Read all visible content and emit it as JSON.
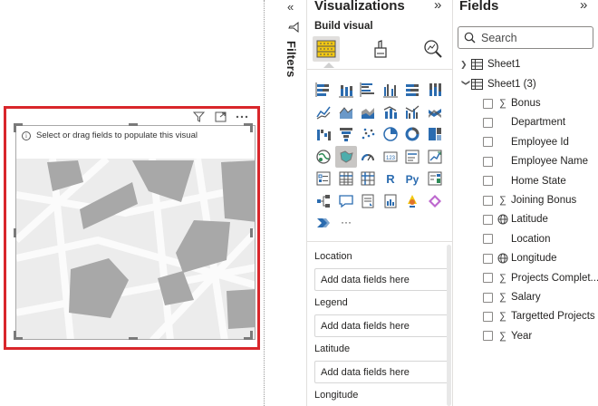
{
  "canvas": {
    "visual": {
      "placeholder_text": "Select or drag fields to populate this visual",
      "header_icons": [
        "filter-icon",
        "focus-mode-icon",
        "more-options-icon"
      ]
    }
  },
  "filters": {
    "label": "Filters",
    "collapse_glyph": "«"
  },
  "visualizations": {
    "title": "Visualizations",
    "expand_glyph": "»",
    "build_label": "Build visual",
    "tabs": [
      "build-visual",
      "format-visual",
      "analytics"
    ],
    "visual_types": [
      "stacked-bar-chart",
      "stacked-column-chart",
      "clustered-bar-chart",
      "clustered-column-chart",
      "100-stacked-bar-chart",
      "100-stacked-column-chart",
      "line-chart",
      "area-chart",
      "stacked-area-chart",
      "line-and-stacked-column-chart",
      "line-and-clustered-column-chart",
      "ribbon-chart",
      "waterfall-chart",
      "funnel-chart",
      "scatter-chart",
      "pie-chart",
      "donut-chart",
      "treemap",
      "map",
      "filled-map",
      "gauge",
      "card",
      "multi-row-card",
      "kpi",
      "slicer",
      "table",
      "matrix",
      "r-script-visual",
      "python-visual",
      "key-influencers",
      "decomposition-tree",
      "qa-visual",
      "smart-narrative",
      "paginated-report",
      "azure-map",
      "power-apps",
      "power-automate",
      "more-visuals"
    ],
    "r_label": "R",
    "py_label": "Py",
    "more_label": "···",
    "wells": [
      {
        "label": "Location",
        "placeholder": "Add data fields here"
      },
      {
        "label": "Legend",
        "placeholder": "Add data fields here"
      },
      {
        "label": "Latitude",
        "placeholder": "Add data fields here"
      },
      {
        "label": "Longitude",
        "placeholder": ""
      }
    ]
  },
  "fields": {
    "title": "Fields",
    "expand_glyph": "»",
    "search_placeholder": "Search",
    "tables": [
      {
        "name": "Sheet1",
        "expanded": false
      },
      {
        "name": "Sheet1 (3)",
        "expanded": true
      }
    ],
    "items": [
      {
        "name": "Bonus",
        "type": "sum"
      },
      {
        "name": "Department",
        "type": "text"
      },
      {
        "name": "Employee Id",
        "type": "text"
      },
      {
        "name": "Employee Name",
        "type": "text"
      },
      {
        "name": "Home State",
        "type": "text"
      },
      {
        "name": "Joining Bonus",
        "type": "sum"
      },
      {
        "name": "Latitude",
        "type": "geo"
      },
      {
        "name": "Location",
        "type": "text"
      },
      {
        "name": "Longitude",
        "type": "geo"
      },
      {
        "name": "Projects Complet...",
        "type": "sum"
      },
      {
        "name": "Salary",
        "type": "sum"
      },
      {
        "name": "Targetted Projects",
        "type": "sum"
      },
      {
        "name": "Year",
        "type": "sum"
      }
    ]
  },
  "colors": {
    "selection_border": "#d9262b",
    "map_blocks": "#a8a8a8",
    "map_background": "#ececec",
    "accent_yellow": "#f2c811"
  }
}
